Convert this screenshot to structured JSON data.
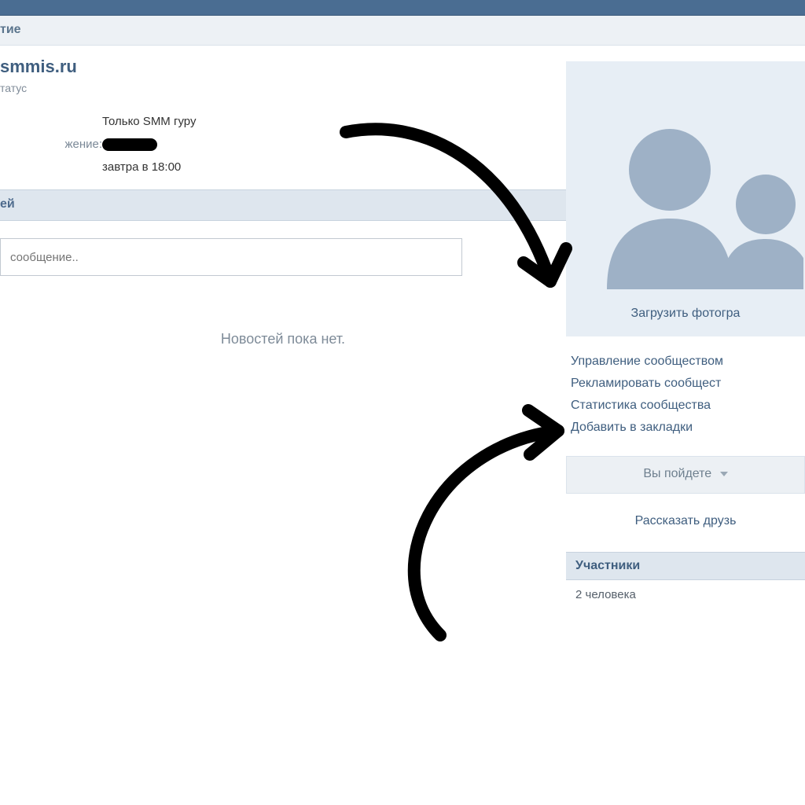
{
  "tab_fragment": "тие",
  "page": {
    "title_fragment": "smmis.ru",
    "status_fragment": "татус",
    "info": {
      "line1_value": "Только SMM гуру",
      "line2_label_fragment": "жение:",
      "line3_value": "завтра в 18:00"
    },
    "wall_header_fragment": "ей",
    "post_placeholder": "сообщение..",
    "no_news": "Новостей пока нет."
  },
  "sidebar": {
    "upload_photo": "Загрузить фотогра",
    "links": [
      "Управление сообществом",
      "Рекламировать сообщест",
      "Статистика сообщества",
      "Добавить в закладки"
    ],
    "attend_label": "Вы пойдете",
    "tell_friends": "Рассказать друзь",
    "members_header": "Участники",
    "members_count": "2 человека"
  }
}
